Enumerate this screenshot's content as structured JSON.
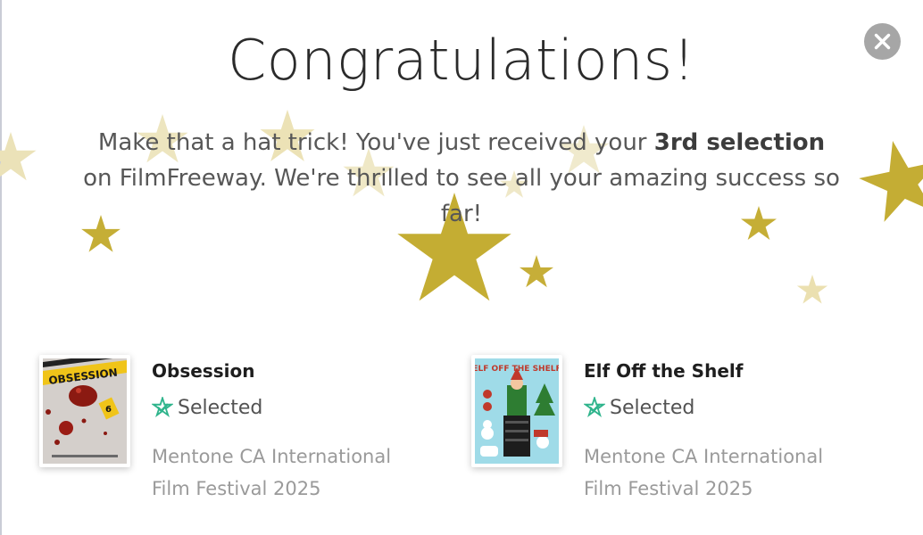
{
  "modal": {
    "title": "Congratulations!",
    "message_before": "Make that a hat trick! You've just received your ",
    "message_bold": "3rd selection",
    "message_after": " on FilmFreeway. We're thrilled to see all your amazing success so far!",
    "close_icon": "close-icon",
    "close_color": "#a6a6a6"
  },
  "colors": {
    "star_gold": "#c5ae36",
    "star_light": "#e8dcaa",
    "selected_green": "#2fb48c",
    "title_text": "#2b2b2b",
    "festival_text": "#9a9a9a"
  },
  "selections": [
    {
      "title": "Obsession",
      "status_icon": "star-badge-icon",
      "status": "Selected",
      "festival": "Mentone CA International Film Festival 2025",
      "poster_text": "OBSESSION"
    },
    {
      "title": "Elf Off the Shelf",
      "status_icon": "star-badge-icon",
      "status": "Selected",
      "festival": "Mentone CA International Film Festival 2025",
      "poster_text": "ELF OFF THE SHELF"
    }
  ]
}
